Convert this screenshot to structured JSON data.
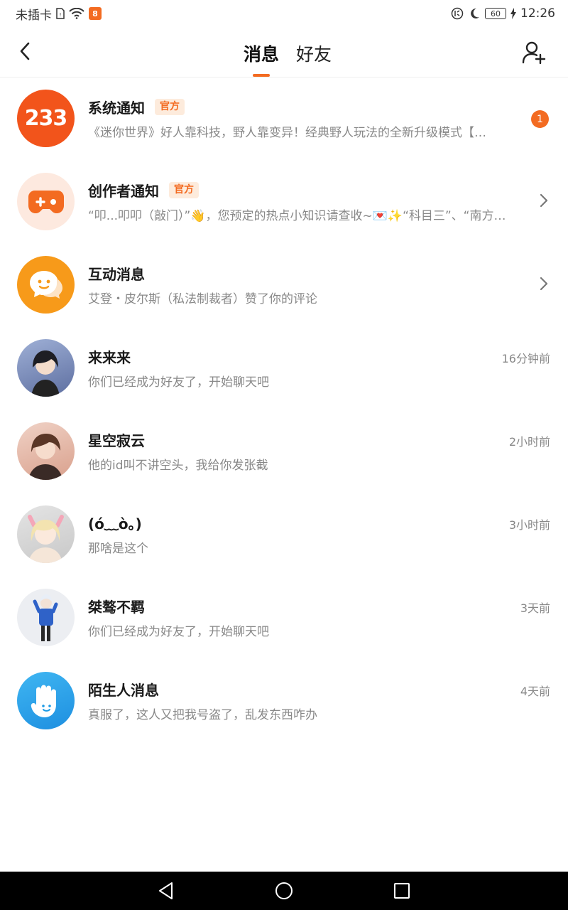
{
  "status_bar": {
    "carrier": "未插卡",
    "app_badge": "8",
    "battery": "60",
    "time": "12:26"
  },
  "header": {
    "tabs": [
      {
        "label": "消息",
        "active": true
      },
      {
        "label": "好友",
        "active": false
      }
    ]
  },
  "messages": [
    {
      "name": "系统通知",
      "tag": "官方",
      "preview": "《迷你世界》好人靠科技，野人靠变异！经典野人玩法的全新升级模式【…",
      "badge": "1",
      "avatar_icon": "233-logo-icon",
      "avatar_text": "233"
    },
    {
      "name": "创作者通知",
      "tag": "官方",
      "preview": "“叩...叩叩（敲门）”👋，您预定的热点小知识请查收~💌✨“科目三”、“南方…",
      "avatar_icon": "gamepad-icon"
    },
    {
      "name": "互动消息",
      "preview": "艾登・皮尔斯（私法制裁者）赞了你的评论",
      "avatar_icon": "chat-bubble-icon"
    },
    {
      "name": "来来来",
      "preview": "你们已经成为好友了，开始聊天吧",
      "time": "16分钟前"
    },
    {
      "name": "星空寂云",
      "preview": "他的id叫不讲空头，我给你发张截",
      "time": "2小时前"
    },
    {
      "name": "(ó﹏ò｡)",
      "preview": "那啥是这个",
      "time": "3小时前"
    },
    {
      "name": "桀骜不羁",
      "preview": "你们已经成为好友了，开始聊天吧",
      "time": "3天前"
    },
    {
      "name": "陌生人消息",
      "preview": "真服了，这人又把我号盗了，乱发东西咋办",
      "time": "4天前",
      "avatar_icon": "waving-hand-icon"
    }
  ],
  "colors": {
    "accent": "#f36b21",
    "tag_bg": "#fdebdc",
    "stranger_blue": "#1e9be6"
  }
}
